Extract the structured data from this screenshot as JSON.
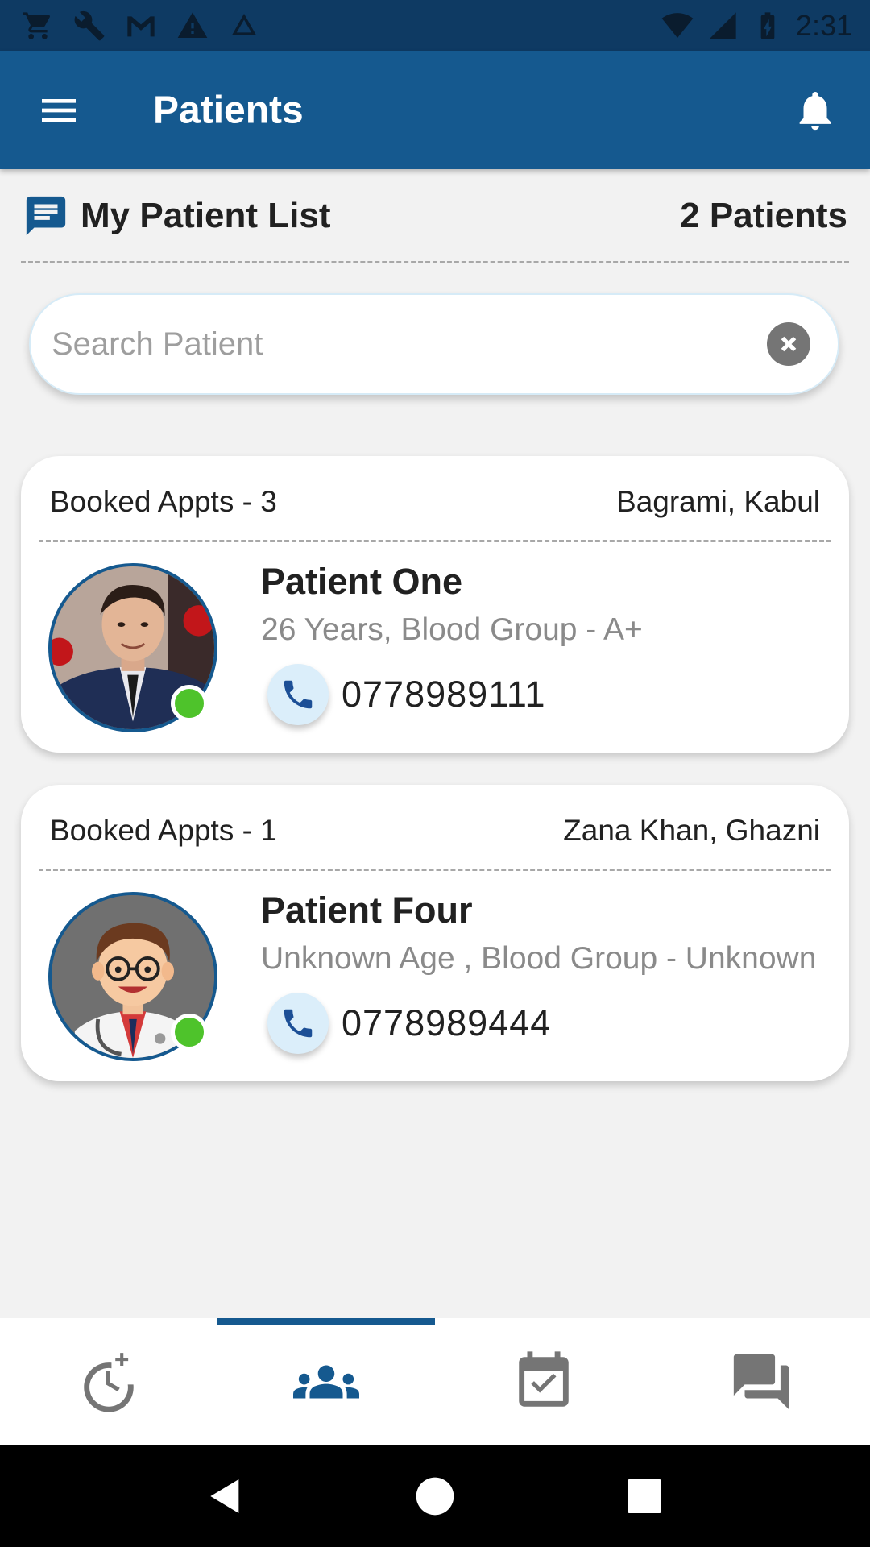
{
  "status_bar": {
    "time": "2:31",
    "left_icons": [
      "cart-icon",
      "wrench-icon",
      "gmail-icon",
      "warning-icon",
      "drive-icon"
    ],
    "right_icons": [
      "wifi-icon",
      "signal-icon",
      "battery-icon"
    ]
  },
  "app_bar": {
    "title": "Patients",
    "menu_icon": "menu-icon",
    "notification_icon": "bell-icon"
  },
  "list_header": {
    "title": "My Patient List",
    "count": "2 Patients",
    "icon": "message-icon"
  },
  "search": {
    "placeholder": "Search Patient",
    "value": ""
  },
  "patients": [
    {
      "booked": "Booked Appts - 3",
      "location": "Bagrami, Kabul",
      "name": "Patient One",
      "info": "26 Years, Blood Group - A+",
      "phone": "0778989111",
      "online": true,
      "avatar": "photo"
    },
    {
      "booked": "Booked Appts - 1",
      "location": "Zana Khan, Ghazni",
      "name": "Patient Four",
      "info": "Unknown Age , Blood Group - Unknown",
      "phone": "0778989444",
      "online": true,
      "avatar": "doctor-cartoon"
    }
  ],
  "bottom_nav": {
    "items": [
      "add-alarm-icon",
      "group-icon",
      "calendar-check-icon",
      "forum-icon"
    ],
    "active_index": 1
  },
  "colors": {
    "primary": "#15598f",
    "status_bar": "#0e3a63",
    "online": "#4ec32b",
    "call_bg": "#dbeefa",
    "call_icon": "#1c4f96"
  }
}
